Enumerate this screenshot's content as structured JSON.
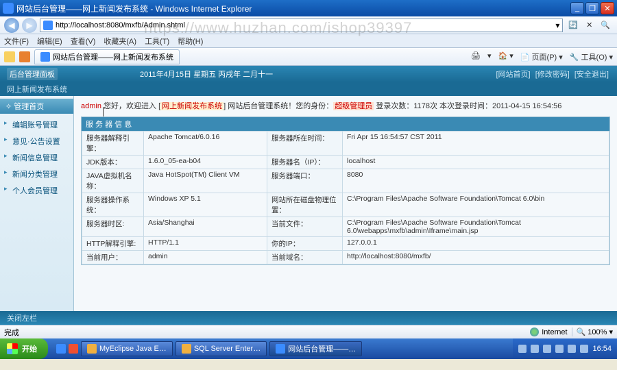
{
  "window": {
    "title": "网站后台管理——网上新闻发布系统 - Windows Internet Explorer",
    "url": "http://localhost:8080/mxfb/Admin.shtml"
  },
  "watermark": "https://www.huzhan.com/ishop39397",
  "menu": [
    "文件(F)",
    "编辑(E)",
    "查看(V)",
    "收藏夹(A)",
    "工具(T)",
    "帮助(H)"
  ],
  "tab": {
    "title": "网站后台管理——网上新闻发布系统"
  },
  "ie_tools": [
    "🖨",
    "▾",
    "🏠 ▾",
    "📄 页面(P) ▾",
    "🔧 工具(O) ▾"
  ],
  "app": {
    "brand": "网上新闻发布系统",
    "header_date": "2011年4月15日  星期五  丙戌年  二月十一",
    "header_badge": "后台管理面板",
    "links": [
      "[网站首页]",
      "[修改密码]",
      "[安全退出]"
    ]
  },
  "sidebar": {
    "head": "✧ 管理首页",
    "items": [
      "编辑账号管理",
      "意见·公告设置",
      "新闻信息管理",
      "新闻分类管理",
      "个人会员管理"
    ]
  },
  "welcome": {
    "user": "admin",
    "t1": " 您好，欢迎进入 [",
    "sys": "网上新闻发布系统",
    "t2": "] 网站后台管理系统！您的身份：",
    "role": "超级管理员",
    "t3": " 登录次数：1178次  本次登录时间：2011-04-15 16:54:56"
  },
  "panel": {
    "title": "服 务 器 信 息",
    "rows": [
      [
        "服务器解释引擎：",
        "Apache Tomcat/6.0.16",
        "服务器所在时间：",
        "Fri Apr 15 16:54:57 CST 2011"
      ],
      [
        "JDK版本：",
        "1.6.0_05-ea-b04",
        "服务器名（IP）：",
        "localhost"
      ],
      [
        "JAVA虚拟机名称：",
        "Java HotSpot(TM) Client VM",
        "服务器端口：",
        "8080"
      ],
      [
        "服务器操作系统：",
        "Windows XP 5.1",
        "网站所在磁盘物理位置：",
        "C:\\Program Files\\Apache Software Foundation\\Tomcat 6.0\\bin"
      ],
      [
        "服务器时区:",
        "Asia/Shanghai",
        "当前文件：",
        "C:\\Program Files\\Apache Software Foundation\\Tomcat 6.0\\webapps\\mxfb\\admin\\Iframe\\main.jsp"
      ],
      [
        "HTTP解释引擎:",
        "HTTP/1.1",
        "你的IP：",
        "127.0.0.1"
      ],
      [
        "当前用户：",
        "admin",
        "当前域名：",
        "http://localhost:8080/mxfb/"
      ]
    ]
  },
  "footer": "关闭左栏",
  "iestatus": {
    "done": "完成",
    "zone": "Internet",
    "zoom": "🔍 100% ▾"
  },
  "taskbar": {
    "start": "开始",
    "items": [
      "MyEclipse Java E…",
      "SQL Server Enter…",
      "网站后台管理——…"
    ],
    "clock": "16:54"
  }
}
